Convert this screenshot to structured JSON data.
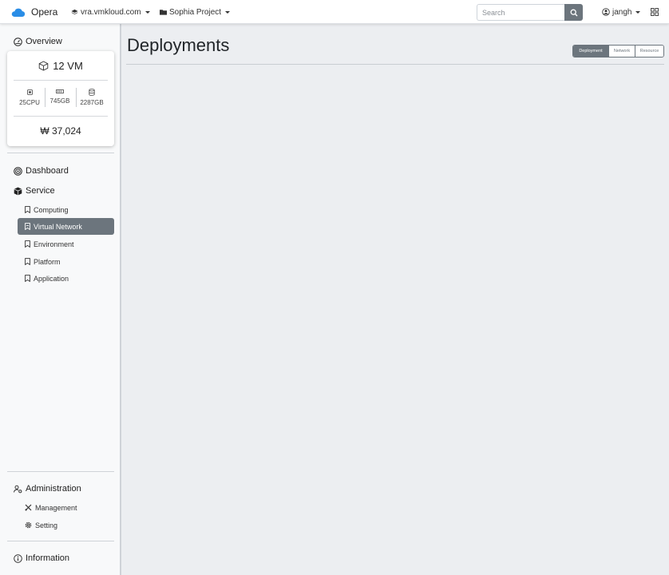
{
  "navbar": {
    "brand": "Opera",
    "host": "vra.vmkloud.com",
    "project": "Sophia Project",
    "search_placeholder": "Search",
    "user": "jangh"
  },
  "sidebar": {
    "overview": {
      "title": "Overview",
      "vm": "12 VM",
      "cpu": "25CPU",
      "memory": "745GB",
      "storage": "2287GB",
      "cost": "₩ 37,024"
    },
    "dashboard": "Dashboard",
    "service": {
      "title": "Service",
      "items": [
        {
          "label": "Computing",
          "icon": "bookmark-icon"
        },
        {
          "label": "Virtual Network",
          "icon": "bookmark-icon",
          "active": true
        },
        {
          "label": "Environment",
          "icon": "bookmark-icon"
        },
        {
          "label": "Platform",
          "icon": "bookmark-icon"
        },
        {
          "label": "Application",
          "icon": "bookmark-icon"
        }
      ]
    },
    "administration": {
      "title": "Administration",
      "items": [
        {
          "label": "Management",
          "icon": "tools-icon"
        },
        {
          "label": "Setting",
          "icon": "gear-icon"
        }
      ]
    },
    "information": "Information"
  },
  "main": {
    "title": "Deployments",
    "view_tabs": [
      "Deployment",
      "Network",
      "Resource"
    ],
    "active_tab": "Deployment"
  },
  "colors": {
    "accent": "#6c757d",
    "brand_cloud": "#2a8de6",
    "background": "#eceef1"
  }
}
